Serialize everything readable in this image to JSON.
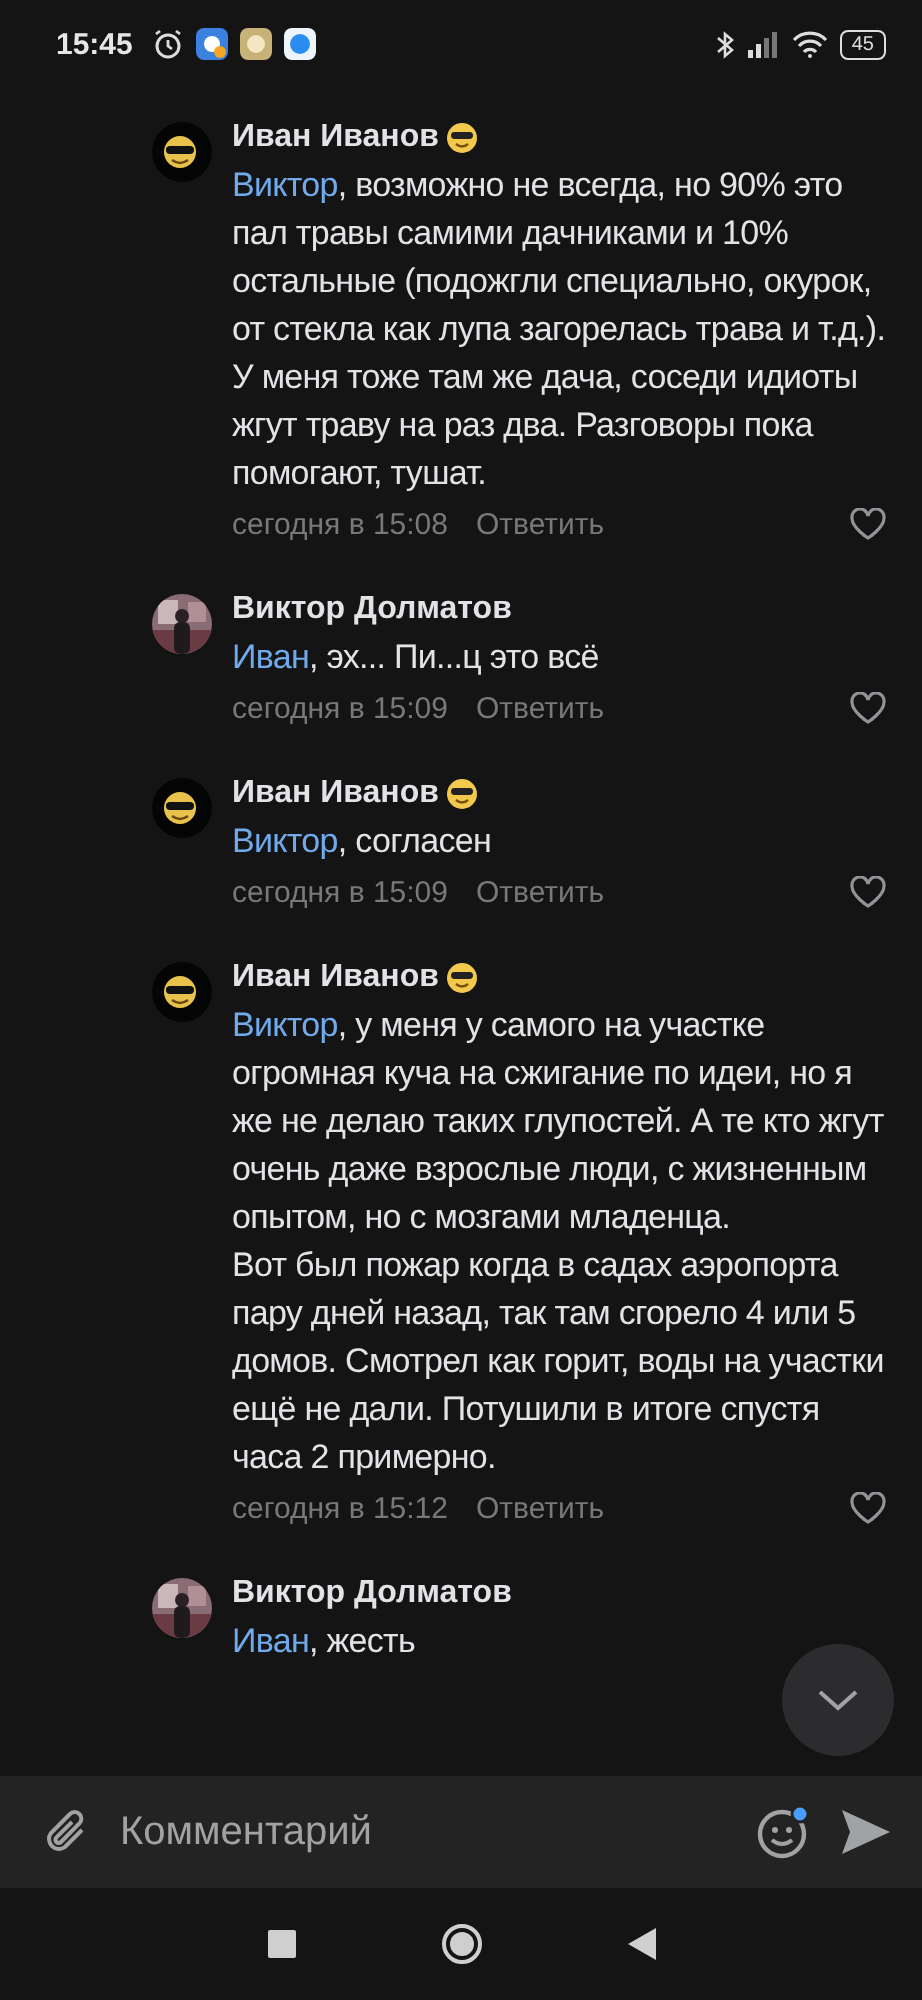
{
  "status_bar": {
    "time": "15:45",
    "battery": "45"
  },
  "comments": [
    {
      "author": "Иван Иванов",
      "emoji": true,
      "avatar": {
        "kind": "emoji"
      },
      "mention": "Виктор",
      "text": ", возможно не всегда, но 90% это пал травы самими дачниками и 10% остальные (подожгли специально, окурок, от стекла как лупа загорелась трава и т.д.).\nУ меня тоже там же дача, соседи идиоты жгут траву на раз два. Разговоры пока помогают, тушат.",
      "time": "сегодня в 15:08",
      "reply": "Ответить",
      "liked": false
    },
    {
      "author": "Виктор Долматов",
      "emoji": false,
      "mention": "Иван",
      "text": ", эх... Пи...ц это всё",
      "time": "сегодня в 15:09",
      "reply": "Ответить",
      "liked": false
    },
    {
      "author": "Иван Иванов",
      "emoji": true,
      "avatar": {
        "kind": "emoji"
      },
      "mention": "Виктор",
      "text": ", согласен",
      "time": "сегодня в 15:09",
      "reply": "Ответить",
      "liked": false
    },
    {
      "author": "Иван Иванов",
      "emoji": true,
      "avatar": {
        "kind": "emoji"
      },
      "mention": "Виктор",
      "text": ", у меня у самого на участке огромная куча на сжигание по идеи, но я же не делаю таких глупостей. А те кто жгут очень даже взрослые люди, с жизненным опытом, но с мозгами младенца.\nВот был пожар когда в садах аэропорта пару дней назад, так там сгорело 4 или 5 домов. Смотрел как горит, воды на участки ещё не дали. Потушили в итоге спустя часа 2 примерно.",
      "time": "сегодня в 15:12",
      "reply": "Ответить",
      "liked": false
    },
    {
      "author": "Виктор Долматов",
      "emoji": false,
      "mention": "Иван",
      "text": ", жесть"
    }
  ],
  "composer": {
    "placeholder": "Комментарий",
    "emoji_badge": true
  }
}
